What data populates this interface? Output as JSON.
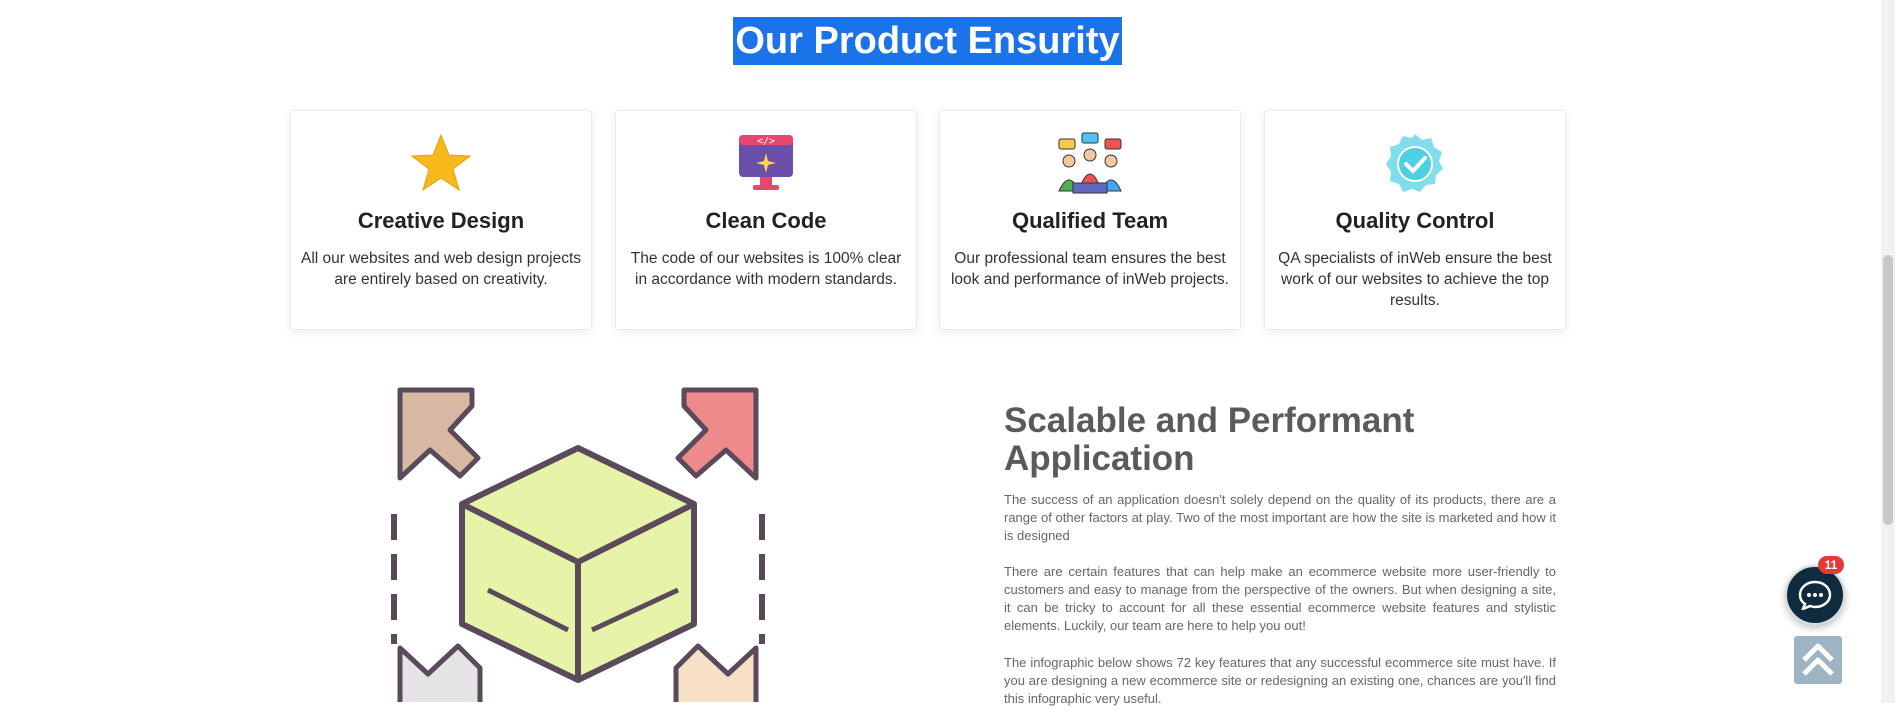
{
  "section_title": "Our Product Ensurity",
  "cards": [
    {
      "title": "Creative Design",
      "text": "All our websites and web design projects are entirely based on creativity.",
      "icon": "star-icon"
    },
    {
      "title": "Clean Code",
      "text": "The code of our websites is 100% clear in accordance with modern standards.",
      "icon": "code-monitor-icon"
    },
    {
      "title": "Qualified Team",
      "text": "Our professional team ensures the best look and performance of inWeb projects.",
      "icon": "team-icon"
    },
    {
      "title": "Quality Control",
      "text": "QA specialists of inWeb ensure the best work of our websites to achieve the top results.",
      "icon": "verified-badge-icon"
    }
  ],
  "scalable": {
    "title_line1": "Scalable and Performant",
    "title_line2": "Application",
    "paragraphs": [
      "The success of an application doesn't solely depend on the quality of its products, there are a range of other factors at play. Two of the most important are how the site is marketed and how it is designed",
      "There are certain features that can help make an ecommerce website more user-friendly to customers and easy to manage from the perspective of the owners. But when designing a site, it can be tricky to account for all these essential ecommerce website features and stylistic elements. Luckily, our team are here to help you out!",
      "The infographic below shows 72 key features that any successful ecommerce site must have. If you are designing a new ecommerce site or redesigning an existing one, chances are you'll find this infographic very useful."
    ]
  },
  "chat": {
    "badge_count": "11",
    "icon": "chat-bubble-icon"
  },
  "scroll_top": {
    "icon": "double-chevron-up-icon"
  },
  "colors": {
    "selection": "#1a73e8",
    "chat_bg": "#0f2b3d",
    "badge": "#e53935"
  }
}
